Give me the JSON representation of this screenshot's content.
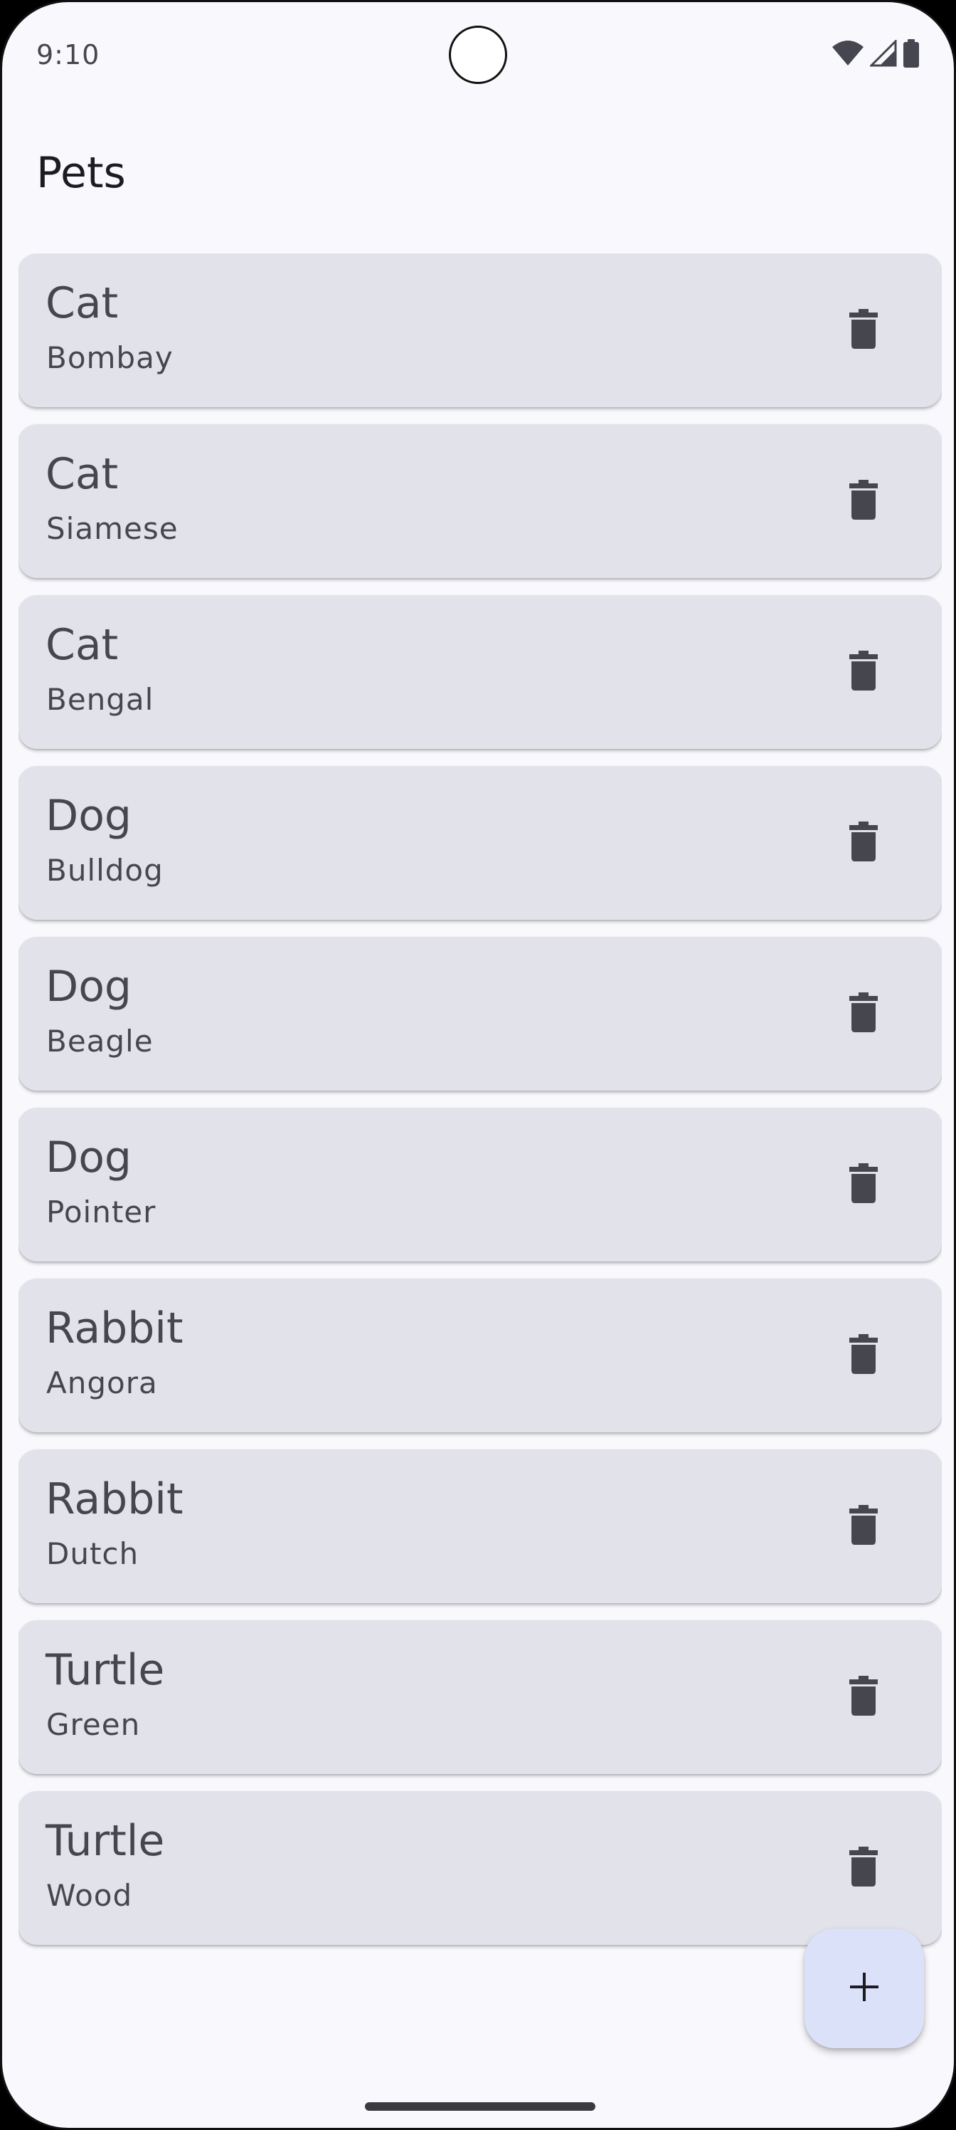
{
  "status_bar": {
    "time": "9:10",
    "icons": [
      "wifi-icon",
      "signal-icon",
      "battery-icon"
    ]
  },
  "app_bar": {
    "title": "Pets"
  },
  "pets": [
    {
      "type": "Cat",
      "breed": "Bombay",
      "action_icon": "delete-icon"
    },
    {
      "type": "Cat",
      "breed": "Siamese",
      "action_icon": "delete-icon"
    },
    {
      "type": "Cat",
      "breed": "Bengal",
      "action_icon": "delete-icon"
    },
    {
      "type": "Dog",
      "breed": "Bulldog",
      "action_icon": "delete-icon"
    },
    {
      "type": "Dog",
      "breed": "Beagle",
      "action_icon": "delete-icon"
    },
    {
      "type": "Dog",
      "breed": "Pointer",
      "action_icon": "delete-icon"
    },
    {
      "type": "Rabbit",
      "breed": "Angora",
      "action_icon": "delete-icon"
    },
    {
      "type": "Rabbit",
      "breed": "Dutch",
      "action_icon": "delete-icon"
    },
    {
      "type": "Turtle",
      "breed": "Green",
      "action_icon": "delete-icon"
    },
    {
      "type": "Turtle",
      "breed": "Wood",
      "action_icon": "delete-icon"
    }
  ],
  "fab": {
    "icon": "add-icon"
  },
  "colors": {
    "background": "#f8f8fd",
    "card": "#e2e2ea",
    "card_text": "#45464f",
    "fab": "#dce1fa",
    "icon": "#45464f"
  }
}
